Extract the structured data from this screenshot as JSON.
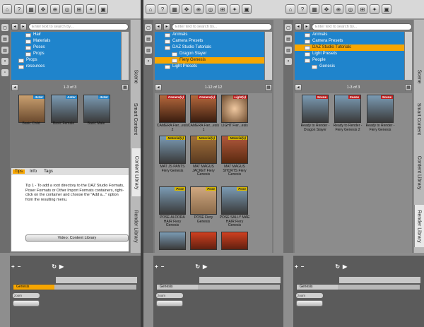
{
  "search_placeholder": "Enter text to search by...",
  "sidebar_tabs": [
    "Scene",
    "Smart Content",
    "Content Library",
    "Render Library"
  ],
  "panel1": {
    "tree": [
      "Hair",
      "Materials",
      "Poses",
      "Props",
      "Props",
      "resources"
    ],
    "page": "1-3 of 3",
    "items": [
      {
        "label": "Basic Child",
        "badge": "Actor"
      },
      {
        "label": "Basic Female",
        "badge": "Actor"
      },
      {
        "label": "Basic Male",
        "badge": "Actor"
      }
    ],
    "tips_tabs": [
      "Tips",
      "Info",
      "Tags"
    ],
    "tip_text": "Tip 1 - To add a root directory to the DAZ Studio Formats, Poser Formats or Other Import Formats containers, right-click on the container and choose the \"Add a...\" option from the resulting menu.",
    "video_button": "Video: Content Library",
    "track": "Genesis"
  },
  "panel2": {
    "tree": [
      "Animals",
      "Camera Presets",
      "DAZ Studio Tutorials",
      "Dragon Slayer",
      "Fiery Genesis",
      "Light Presets"
    ],
    "page": "1-12 of 12",
    "items": [
      {
        "label": "CAMERA Fier...esis 2",
        "badge": "Camera(s)"
      },
      {
        "label": "CAMERA Fier...esis 1",
        "badge": "Camera(s)"
      },
      {
        "label": "LIGHT Fier...esis",
        "badge": "Light(s)"
      },
      {
        "label": "MAT JS PANTS Fiery Genesis",
        "badge": "Material(s)"
      },
      {
        "label": "MAT MAGUS JACKET Fiery Genesis",
        "badge": "Material(s)"
      },
      {
        "label": "MAT MAGUS SHORTS Fiery Genesis",
        "badge": "Material(s)"
      },
      {
        "label": "POSE ALDORA HAIR Fiery Genesis",
        "badge": "Pose"
      },
      {
        "label": "POSE Fiery Genesis",
        "badge": "Pose"
      },
      {
        "label": "POSE SALLY MAE HAIR Fiery Genesis",
        "badge": "Pose"
      }
    ],
    "track": "Genesis"
  },
  "panel3": {
    "tree": [
      "Animals",
      "Camera Presets",
      "DAZ Studio Tutorials",
      "Light Presets",
      "People",
      "Genesis"
    ],
    "page": "1-3 of 3",
    "items": [
      {
        "label": "Ready to Render - Dragon Slayer",
        "badge": "Scene"
      },
      {
        "label": "Ready to Render - Fiery Genesis 2",
        "badge": "Scene"
      },
      {
        "label": "Ready to Render - Fiery Genesis",
        "badge": "Scene"
      }
    ],
    "track": "Genesis"
  },
  "zoom_label": "zoom",
  "colors": {
    "accent": "#f7a600",
    "tree": "#1f84cc"
  }
}
